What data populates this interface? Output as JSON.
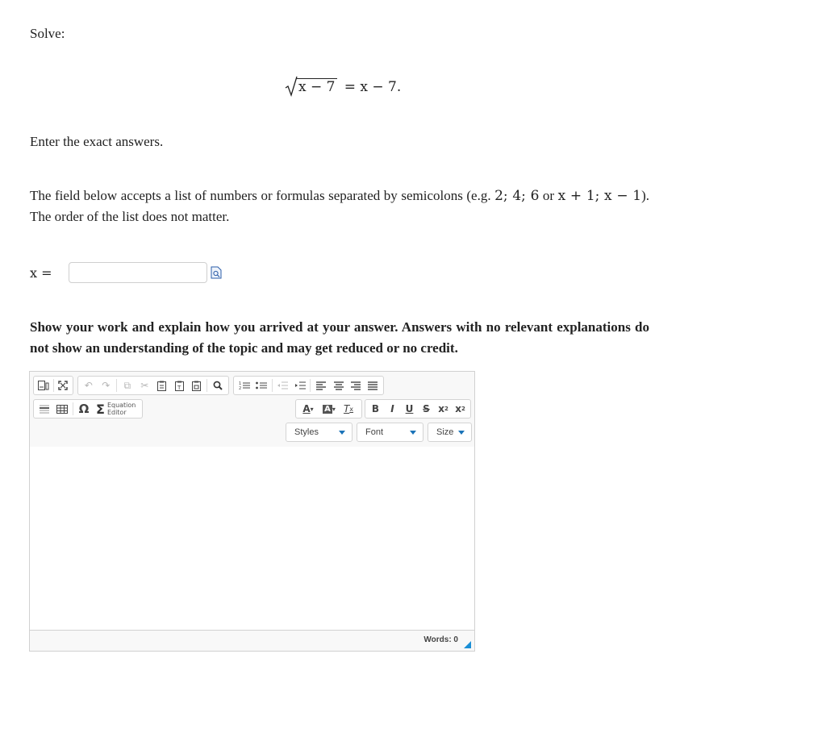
{
  "question": {
    "label": "Solve:",
    "equation": {
      "radicand": "x − 7",
      "rhs": "= x − 7."
    },
    "instruction": "Enter the exact answers.",
    "hint_prefix": "The field below accepts a list of numbers or formulas separated by semicolons (e.g. ",
    "hint_example1": "2; 4; 6",
    "hint_or": " or ",
    "hint_example2": "x + 1; x − 1",
    "hint_suffix": "). The order of the list does not matter.",
    "answer_var": "x =",
    "answer_value": "",
    "work_prompt": "Show your work and explain how you arrived at your answer. Answers with no relevant explanations do not show an understanding of the topic and may get reduced or no credit."
  },
  "editor": {
    "equation_button": "Equation Editor",
    "styles_label": "Styles",
    "font_label": "Font",
    "size_label": "Size",
    "word_count": "Words: 0",
    "accent_color": "#1a8fd6"
  }
}
